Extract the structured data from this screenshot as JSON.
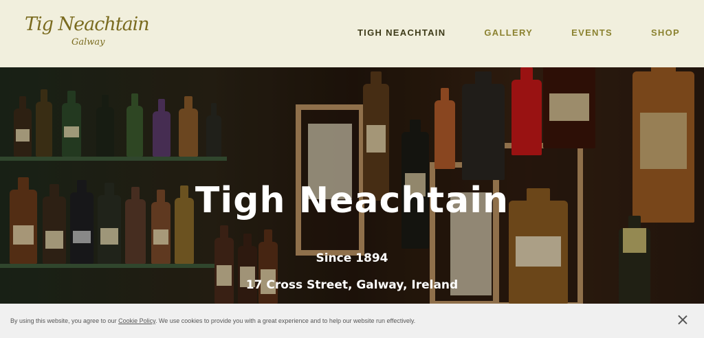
{
  "logo": {
    "main": "Tig Neachtain",
    "sub": "Galway"
  },
  "nav": [
    {
      "label": "TIGH NEACHTAIN"
    },
    {
      "label": "GALLERY"
    },
    {
      "label": "EVENTS"
    },
    {
      "label": "SHOP"
    }
  ],
  "hero": {
    "title": "Tigh Neachtain",
    "since": "Since 1894",
    "address": "17 Cross Street, Galway, Ireland"
  },
  "cookie": {
    "text_before": "By using this website, you agree to our ",
    "link": "Cookie Policy",
    "text_after": ". We use cookies to provide you with a great experience and to help our website run effectively."
  },
  "icons": {
    "close": "close-icon"
  },
  "colors": {
    "header_bg": "#f1efdd",
    "nav": "#8b8230",
    "nav_active": "#3d3a18",
    "logo": "#7a6b1f"
  }
}
